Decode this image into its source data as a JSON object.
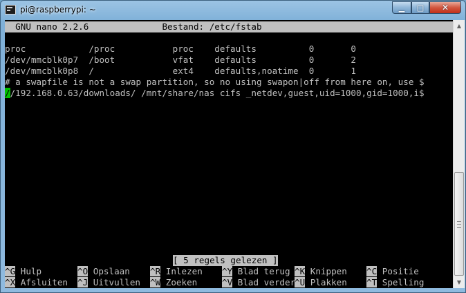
{
  "window": {
    "title": "pi@raspberrypi: ~",
    "minimize_glyph": "▁",
    "maximize_glyph": "□",
    "close_glyph": "✕"
  },
  "nano": {
    "header": "  GNU nano 2.2.6              Bestand: /etc/fstab",
    "lines": [
      "",
      "proc            /proc           proc    defaults          0       0",
      "/dev/mmcblk0p7  /boot           vfat    defaults          0       2",
      "/dev/mmcblk0p8  /               ext4    defaults,noatime  0       1",
      "# a swapfile is not a swap partition, so no using swapon|off from here on, use $"
    ],
    "cursor_char": "/",
    "cursor_line_rest": "/192.168.0.63/downloads/ /mnt/share/nas cifs _netdev,guest,uid=1000,gid=1000,i$",
    "status_message": "[ 5 regels gelezen ]",
    "shortcuts_row1": [
      {
        "key": "^G",
        "label": " Hulp"
      },
      {
        "key": "^O",
        "label": " Opslaan"
      },
      {
        "key": "^R",
        "label": " Inlezen"
      },
      {
        "key": "^Y",
        "label": " Blad terug"
      },
      {
        "key": "^K",
        "label": " Knippen"
      },
      {
        "key": "^C",
        "label": " Positie"
      }
    ],
    "shortcuts_row2": [
      {
        "key": "^X",
        "label": " Afsluiten"
      },
      {
        "key": "^J",
        "label": " Uitvullen"
      },
      {
        "key": "^W",
        "label": " Zoeken"
      },
      {
        "key": "^V",
        "label": " Blad verder"
      },
      {
        "key": "^U",
        "label": " Plakken"
      },
      {
        "key": "^T",
        "label": " Spelling"
      }
    ]
  },
  "colors": {
    "terminal_bg": "#000000",
    "terminal_fg": "#c0c0c0",
    "cursor": "#00c000"
  }
}
